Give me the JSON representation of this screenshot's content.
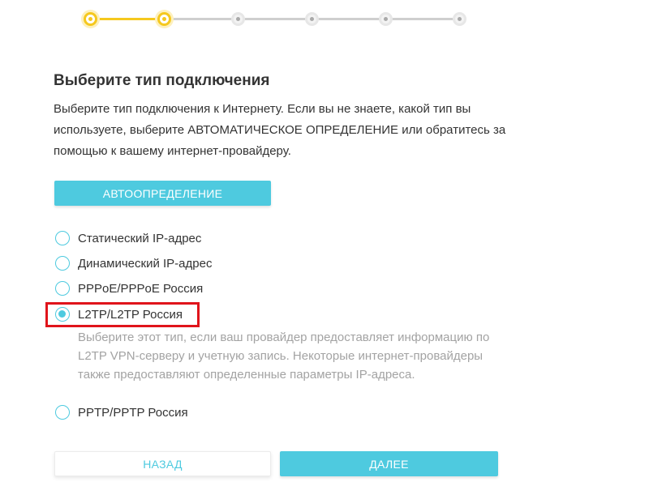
{
  "stepper": {
    "steps": [
      "done",
      "current",
      "pending",
      "pending",
      "pending",
      "pending"
    ],
    "active_color": "#f5c81e",
    "inactive_color": "#cfcfcf"
  },
  "page": {
    "title": "Выберите тип подключения",
    "description": "Выберите тип подключения к Интернету. Если вы не знаете, какой тип вы используете, выберите АВТОМАТИЧЕСКОЕ ОПРЕДЕЛЕНИЕ или обратитесь за помощью к вашему интернет-провайдеру."
  },
  "auto_detect": {
    "label": "АВТООПРЕДЕЛЕНИЕ"
  },
  "options": {
    "static": {
      "label": "Статический IP-адрес",
      "checked": false
    },
    "dynamic": {
      "label": "Динамический IP-адрес",
      "checked": false
    },
    "pppoe": {
      "label": "PPPoE/PPPoE Россия",
      "checked": false
    },
    "l2tp": {
      "label": "L2TP/L2TP Россия",
      "checked": true,
      "description": "Выберите этот тип, если ваш провайдер предоставляет информацию по L2TP VPN-серверу и учетную запись. Некоторые интернет-провайдеры также предоставляют определенные параметры IP-адреса."
    },
    "pptp": {
      "label": "PPTP/PPTP Россия",
      "checked": false
    }
  },
  "footer": {
    "back_label": "НАЗАД",
    "next_label": "ДАЛЕЕ"
  },
  "colors": {
    "accent": "#4ecadf",
    "highlight": "#e0141b",
    "text": "#333333",
    "muted": "#a3a3a3"
  }
}
